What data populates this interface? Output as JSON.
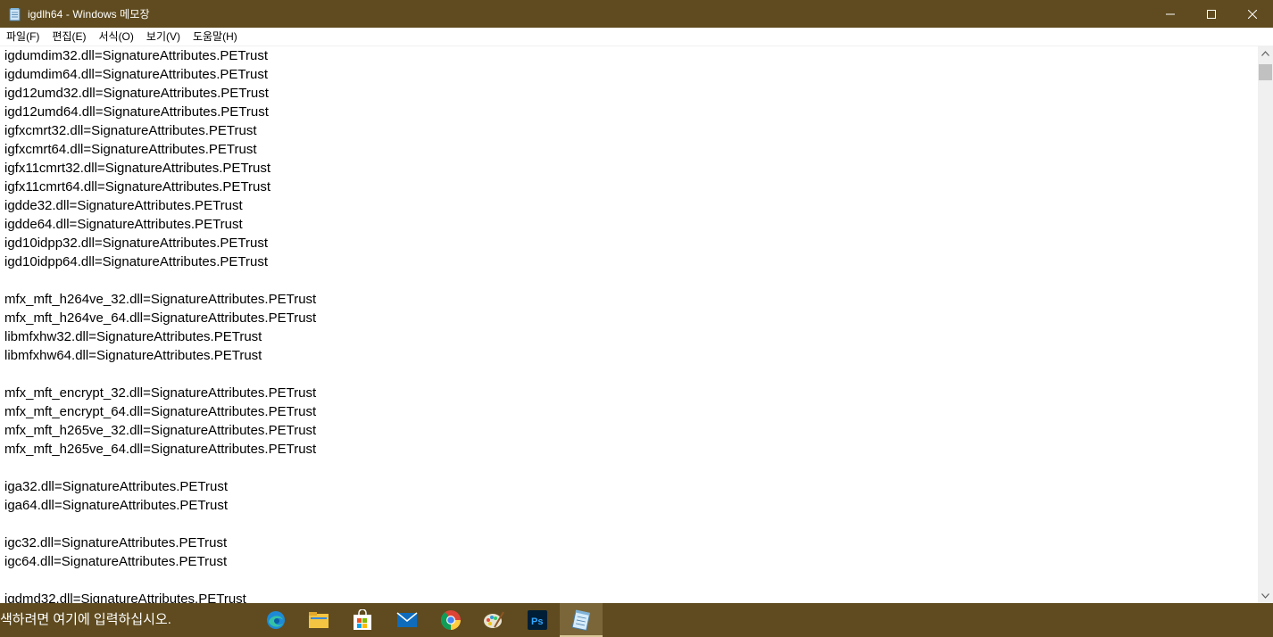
{
  "window": {
    "title": "igdlh64 - Windows 메모장",
    "minimize_glyph": "—",
    "maximize_glyph": "☐",
    "close_glyph": "✕"
  },
  "menu": [
    "파일(F)",
    "편집(E)",
    "서식(O)",
    "보기(V)",
    "도움말(H)"
  ],
  "document": {
    "lines": [
      "igdumdim32.dll=SignatureAttributes.PETrust",
      "igdumdim64.dll=SignatureAttributes.PETrust",
      "igd12umd32.dll=SignatureAttributes.PETrust",
      "igd12umd64.dll=SignatureAttributes.PETrust",
      "igfxcmrt32.dll=SignatureAttributes.PETrust",
      "igfxcmrt64.dll=SignatureAttributes.PETrust",
      "igfx11cmrt32.dll=SignatureAttributes.PETrust",
      "igfx11cmrt64.dll=SignatureAttributes.PETrust",
      "igdde32.dll=SignatureAttributes.PETrust",
      "igdde64.dll=SignatureAttributes.PETrust",
      "igd10idpp32.dll=SignatureAttributes.PETrust",
      "igd10idpp64.dll=SignatureAttributes.PETrust",
      "",
      "mfx_mft_h264ve_32.dll=SignatureAttributes.PETrust",
      "mfx_mft_h264ve_64.dll=SignatureAttributes.PETrust",
      "libmfxhw32.dll=SignatureAttributes.PETrust",
      "libmfxhw64.dll=SignatureAttributes.PETrust",
      "",
      "mfx_mft_encrypt_32.dll=SignatureAttributes.PETrust",
      "mfx_mft_encrypt_64.dll=SignatureAttributes.PETrust",
      "mfx_mft_h265ve_32.dll=SignatureAttributes.PETrust",
      "mfx_mft_h265ve_64.dll=SignatureAttributes.PETrust",
      "",
      "iga32.dll=SignatureAttributes.PETrust",
      "iga64.dll=SignatureAttributes.PETrust",
      "",
      "igc32.dll=SignatureAttributes.PETrust",
      "igc64.dll=SignatureAttributes.PETrust",
      "",
      "igdmd32.dll=SignatureAttributes.PETrust"
    ]
  },
  "taskbar": {
    "search_placeholder": "색하려면 여기에 입력하십시오.",
    "apps": [
      {
        "name": "edge-icon",
        "active": false
      },
      {
        "name": "file-explorer-icon",
        "active": false
      },
      {
        "name": "store-icon",
        "active": false
      },
      {
        "name": "mail-icon",
        "active": false
      },
      {
        "name": "chrome-icon",
        "active": false
      },
      {
        "name": "paint-icon",
        "active": false
      },
      {
        "name": "photoshop-icon",
        "active": false,
        "label": "Ps"
      },
      {
        "name": "notepad-icon",
        "active": true
      }
    ]
  },
  "colors": {
    "accent": "#5f4b1f",
    "taskbar_active": "#7a6639"
  }
}
